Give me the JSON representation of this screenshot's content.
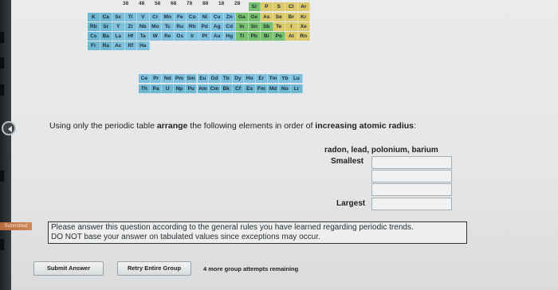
{
  "periodic_table": {
    "header_numbers": [
      "38",
      "48",
      "58",
      "68",
      "78",
      "88",
      "18",
      "28"
    ],
    "rows": [
      {
        "cells": [
          [
            "K",
            "#6fb8d3"
          ],
          [
            "Ca",
            "#6fb8d3"
          ],
          [
            "Sc",
            "#7cc0de"
          ],
          [
            "Ti",
            "#7cc0de"
          ],
          [
            "V",
            "#7cc0de"
          ],
          [
            "Cr",
            "#7cc0de"
          ],
          [
            "Mn",
            "#7cc0de"
          ],
          [
            "Fe",
            "#7cc0de"
          ],
          [
            "Co",
            "#7cc0de"
          ],
          [
            "Ni",
            "#7cc0de"
          ],
          [
            "Cu",
            "#7cc0de"
          ],
          [
            "Zn",
            "#7cc0de"
          ],
          [
            "Ga",
            "#77c06f"
          ],
          [
            "Ge",
            "#77c06f"
          ],
          [
            "As",
            "#dcc96a"
          ],
          [
            "Se",
            "#dcc96a"
          ],
          [
            "Br",
            "#dcc96a"
          ],
          [
            "Kr",
            "#dcc96a"
          ]
        ]
      },
      {
        "cells": [
          [
            "Rb",
            "#6fb8d3"
          ],
          [
            "Sr",
            "#6fb8d3"
          ],
          [
            "Y",
            "#7cc0de"
          ],
          [
            "Zr",
            "#7cc0de"
          ],
          [
            "Nb",
            "#7cc0de"
          ],
          [
            "Mo",
            "#7cc0de"
          ],
          [
            "Tc",
            "#7cc0de"
          ],
          [
            "Ru",
            "#7cc0de"
          ],
          [
            "Rh",
            "#7cc0de"
          ],
          [
            "Pd",
            "#7cc0de"
          ],
          [
            "Ag",
            "#7cc0de"
          ],
          [
            "Cd",
            "#7cc0de"
          ],
          [
            "In",
            "#77c06f"
          ],
          [
            "Sn",
            "#77c06f"
          ],
          [
            "Sb",
            "#77c06f"
          ],
          [
            "Te",
            "#dcc96a"
          ],
          [
            "I",
            "#dcc96a"
          ],
          [
            "Xe",
            "#dcc96a"
          ]
        ]
      },
      {
        "cells": [
          [
            "Cs",
            "#6fb8d3"
          ],
          [
            "Ba",
            "#6fb8d3"
          ],
          [
            "La",
            "#7cc0de"
          ],
          [
            "Hf",
            "#7cc0de"
          ],
          [
            "Ta",
            "#7cc0de"
          ],
          [
            "W",
            "#7cc0de"
          ],
          [
            "Re",
            "#7cc0de"
          ],
          [
            "Os",
            "#7cc0de"
          ],
          [
            "Ir",
            "#7cc0de"
          ],
          [
            "Pt",
            "#7cc0de"
          ],
          [
            "Au",
            "#7cc0de"
          ],
          [
            "Hg",
            "#7cc0de"
          ],
          [
            "Tl",
            "#77c06f"
          ],
          [
            "Pb",
            "#77c06f"
          ],
          [
            "Bi",
            "#77c06f"
          ],
          [
            "Po",
            "#77c06f"
          ],
          [
            "At",
            "#dcc96a"
          ],
          [
            "Rn",
            "#dcc96a"
          ]
        ]
      },
      {
        "cells": [
          [
            "Fr",
            "#6fb8d3"
          ],
          [
            "Ra",
            "#6fb8d3"
          ],
          [
            "Ac",
            "#7cc0de"
          ],
          [
            "Rf",
            "#7cc0de"
          ],
          [
            "Ha",
            "#7cc0de"
          ]
        ]
      }
    ],
    "lanthanides": [
      "Ce",
      "Pr",
      "Nd",
      "Pm",
      "Sm",
      "Eu",
      "Gd",
      "Tb",
      "Dy",
      "Ho",
      "Er",
      "Tm",
      "Yb",
      "Lu"
    ],
    "actinides": [
      "Th",
      "Pa",
      "U",
      "Np",
      "Pu",
      "Am",
      "Cm",
      "Bk",
      "Cf",
      "Es",
      "Fm",
      "Md",
      "No",
      "Lr"
    ],
    "top_right_symbols": [
      "Si",
      "P",
      "S",
      "Cl",
      "Ar"
    ]
  },
  "question": {
    "prefix": "Using only the periodic table ",
    "bold1": "arrange",
    "middle": " the following elements in order of ",
    "bold2": "increasing atomic radius",
    "suffix": ":"
  },
  "elements_list": "radon, lead, polonium, barium",
  "smallest_label": "Smallest",
  "largest_label": "Largest",
  "answer_values": [
    "",
    "",
    "",
    ""
  ],
  "submitted_tag": "Submitted",
  "note_line1": "Please answer this question according to the general rules you have learned regarding periodic trends.",
  "note_line2": "DO NOT base your answer on tabulated values since exceptions may occur.",
  "buttons": {
    "submit": "Submit Answer",
    "retry": "Retry Entire Group"
  },
  "attempts_text": "4 more group attempts remaining"
}
